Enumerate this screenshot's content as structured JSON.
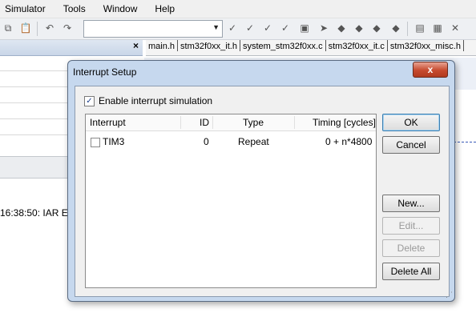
{
  "menu": [
    "Simulator",
    "Tools",
    "Window",
    "Help"
  ],
  "tabs": [
    "main.h",
    "stm32f0xx_it.h",
    "system_stm32f0xx.c",
    "stm32f0xx_it.c",
    "stm32f0xx_misc.h"
  ],
  "log": {
    "line": "16:38:50: IAR E"
  },
  "dialog": {
    "title": "Interrupt Setup",
    "close": "x",
    "enable_label": "Enable interrupt simulation",
    "enable_checked": true,
    "columns": [
      "Interrupt",
      "ID",
      "Type",
      "Timing [cycles]"
    ],
    "rows": [
      {
        "name": "TIM3",
        "id": "0",
        "type": "Repeat",
        "timing": "0 + n*4800",
        "checked": false
      }
    ],
    "buttons": {
      "ok": "OK",
      "cancel": "Cancel",
      "new": "New...",
      "edit": "Edit...",
      "delete": "Delete",
      "delete_all": "Delete All"
    }
  }
}
